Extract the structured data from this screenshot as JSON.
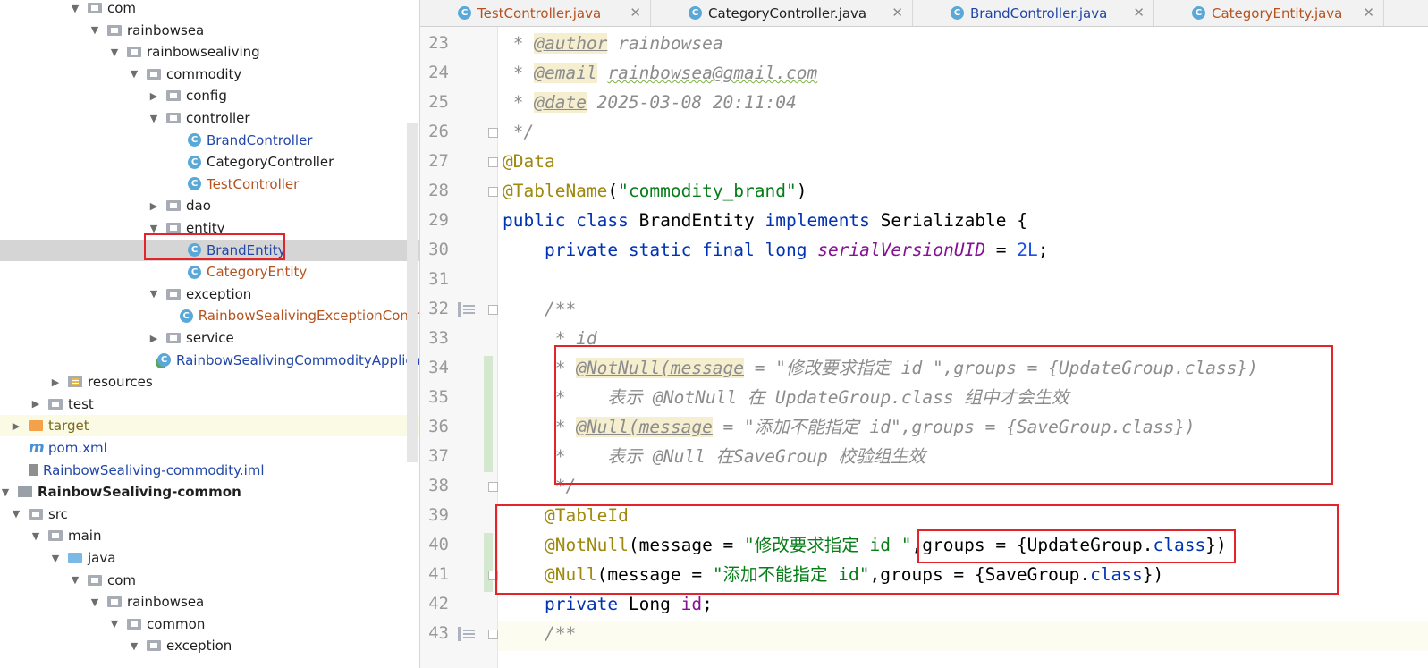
{
  "tree": {
    "rows": [
      {
        "label": "com",
        "indent": 78,
        "arrow": "▼",
        "icon": "folder",
        "color": "",
        "selected": false
      },
      {
        "label": "rainbowsea",
        "indent": 100,
        "arrow": "▼",
        "icon": "folder",
        "color": ""
      },
      {
        "label": "rainbowsealiving",
        "indent": 122,
        "arrow": "▼",
        "icon": "folder",
        "color": ""
      },
      {
        "label": "commodity",
        "indent": 144,
        "arrow": "▼",
        "icon": "folder",
        "color": ""
      },
      {
        "label": "config",
        "indent": 166,
        "arrow": "▶",
        "icon": "folder",
        "color": ""
      },
      {
        "label": "controller",
        "indent": 166,
        "arrow": "▼",
        "icon": "folder",
        "color": ""
      },
      {
        "label": "BrandController",
        "indent": 190,
        "arrow": "",
        "icon": "class",
        "color": "blue"
      },
      {
        "label": "CategoryController",
        "indent": 190,
        "arrow": "",
        "icon": "class",
        "color": ""
      },
      {
        "label": "TestController",
        "indent": 190,
        "arrow": "",
        "icon": "class",
        "color": "orange"
      },
      {
        "label": "dao",
        "indent": 166,
        "arrow": "▶",
        "icon": "folder",
        "color": ""
      },
      {
        "label": "entity",
        "indent": 166,
        "arrow": "▼",
        "icon": "folder",
        "color": ""
      },
      {
        "label": "BrandEntity",
        "indent": 190,
        "arrow": "",
        "icon": "class",
        "color": "blue",
        "selected": true
      },
      {
        "label": "CategoryEntity",
        "indent": 190,
        "arrow": "",
        "icon": "class",
        "color": "orange"
      },
      {
        "label": "exception",
        "indent": 166,
        "arrow": "▼",
        "icon": "folder",
        "color": ""
      },
      {
        "label": "RainbowSealivingExceptionContr",
        "indent": 190,
        "arrow": "",
        "icon": "class",
        "color": "orange"
      },
      {
        "label": "service",
        "indent": 166,
        "arrow": "▶",
        "icon": "folder",
        "color": ""
      },
      {
        "label": "RainbowSealivingCommodityApplica",
        "indent": 168,
        "arrow": "",
        "icon": "app",
        "color": "blue"
      },
      {
        "label": "resources",
        "indent": 56,
        "arrow": "▶",
        "icon": "resources",
        "color": ""
      },
      {
        "label": "test",
        "indent": 34,
        "arrow": "▶",
        "icon": "folder",
        "color": ""
      },
      {
        "label": "target",
        "indent": 12,
        "arrow": "▶",
        "icon": "folder-orange",
        "color": "olive",
        "hl": true
      },
      {
        "label": "pom.xml",
        "indent": 12,
        "arrow": "",
        "icon": "maven",
        "color": "blue"
      },
      {
        "label": "RainbowSealiving-commodity.iml",
        "indent": 12,
        "arrow": "",
        "icon": "iml",
        "color": "blue"
      },
      {
        "label": "RainbowSealiving-common",
        "indent": 0,
        "arrow": "▼",
        "icon": "module",
        "color": "",
        "bold": true
      },
      {
        "label": "src",
        "indent": 12,
        "arrow": "▼",
        "icon": "folder",
        "color": ""
      },
      {
        "label": "main",
        "indent": 34,
        "arrow": "▼",
        "icon": "folder",
        "color": ""
      },
      {
        "label": "java",
        "indent": 56,
        "arrow": "▼",
        "icon": "folder-blue",
        "color": ""
      },
      {
        "label": "com",
        "indent": 78,
        "arrow": "▼",
        "icon": "folder",
        "color": ""
      },
      {
        "label": "rainbowsea",
        "indent": 100,
        "arrow": "▼",
        "icon": "folder",
        "color": ""
      },
      {
        "label": "common",
        "indent": 122,
        "arrow": "▼",
        "icon": "folder",
        "color": ""
      },
      {
        "label": "exception",
        "indent": 144,
        "arrow": "▼",
        "icon": "folder",
        "color": ""
      }
    ]
  },
  "tabs": [
    {
      "label": "TestController.java",
      "color": "#b5531f",
      "close": "✕"
    },
    {
      "label": "CategoryController.java",
      "color": "#1f1f1f",
      "close": "✕"
    },
    {
      "label": "BrandController.java",
      "color": "#2146a8",
      "close": "✕"
    },
    {
      "label": "CategoryEntity.java",
      "color": "#b5531f",
      "close": "✕"
    }
  ],
  "editor": {
    "lines": [
      {
        "n": "23",
        "segs": [
          {
            "c": "cm",
            "t": " * "
          },
          {
            "c": "tag",
            "t": "@author"
          },
          {
            "c": "cm",
            "t": " rainbowsea"
          }
        ]
      },
      {
        "n": "24",
        "segs": [
          {
            "c": "cm",
            "t": " * "
          },
          {
            "c": "tag",
            "t": "@email"
          },
          {
            "c": "cm",
            "t": " "
          },
          {
            "c": "cm squig",
            "t": "rainbowsea@gmail.com"
          }
        ]
      },
      {
        "n": "25",
        "segs": [
          {
            "c": "cm",
            "t": " * "
          },
          {
            "c": "tag",
            "t": "@date"
          },
          {
            "c": "cm",
            "t": " 2025-03-08 20:11:04"
          }
        ]
      },
      {
        "n": "26",
        "segs": [
          {
            "c": "cm",
            "t": " */"
          }
        ]
      },
      {
        "n": "27",
        "segs": [
          {
            "c": "ann",
            "t": "@Data"
          }
        ]
      },
      {
        "n": "28",
        "segs": [
          {
            "c": "ann",
            "t": "@TableName"
          },
          {
            "c": "",
            "t": "("
          },
          {
            "c": "str",
            "t": "\"commodity_brand\""
          },
          {
            "c": "",
            "t": ")"
          }
        ]
      },
      {
        "n": "29",
        "segs": [
          {
            "c": "kw",
            "t": "public class "
          },
          {
            "c": "",
            "t": "BrandEntity "
          },
          {
            "c": "kw",
            "t": "implements "
          },
          {
            "c": "",
            "t": "Serializable {"
          }
        ]
      },
      {
        "n": "30",
        "segs": [
          {
            "c": "",
            "t": "    "
          },
          {
            "c": "kw",
            "t": "private static final long "
          },
          {
            "c": "fld",
            "t": "serialVersionUID"
          },
          {
            "c": "",
            "t": " = "
          },
          {
            "c": "num",
            "t": "2L"
          },
          {
            "c": "",
            "t": ";"
          }
        ]
      },
      {
        "n": "31",
        "segs": []
      },
      {
        "n": "32",
        "segs": [
          {
            "c": "cm",
            "t": "    /**"
          }
        ]
      },
      {
        "n": "33",
        "segs": [
          {
            "c": "cm",
            "t": "     * id"
          }
        ]
      },
      {
        "n": "34",
        "segs": [
          {
            "c": "cm",
            "t": "     * "
          },
          {
            "c": "tag",
            "t": "@NotNull(message"
          },
          {
            "c": "cm",
            "t": " = \"修改要求指定 id \",groups = {UpdateGroup.class})"
          }
        ]
      },
      {
        "n": "35",
        "segs": [
          {
            "c": "cm",
            "t": "     *    表示 @NotNull 在 UpdateGroup.class 组中才会生效"
          }
        ]
      },
      {
        "n": "36",
        "segs": [
          {
            "c": "cm",
            "t": "     * "
          },
          {
            "c": "tag",
            "t": "@Null(message"
          },
          {
            "c": "cm",
            "t": " = \"添加不能指定 id\",groups = {SaveGroup.class})"
          }
        ]
      },
      {
        "n": "37",
        "segs": [
          {
            "c": "cm",
            "t": "     *    表示 @Null 在SaveGroup 校验组生效"
          }
        ]
      },
      {
        "n": "38",
        "segs": [
          {
            "c": "cm",
            "t": "     */"
          }
        ]
      },
      {
        "n": "39",
        "segs": [
          {
            "c": "",
            "t": "    "
          },
          {
            "c": "ann",
            "t": "@TableId"
          }
        ]
      },
      {
        "n": "40",
        "segs": [
          {
            "c": "",
            "t": "    "
          },
          {
            "c": "ann",
            "t": "@NotNull"
          },
          {
            "c": "",
            "t": "(message = "
          },
          {
            "c": "str",
            "t": "\"修改要求指定 id \""
          },
          {
            "c": "",
            "t": ",groups = {UpdateGroup."
          },
          {
            "c": "kw",
            "t": "class"
          },
          {
            "c": "",
            "t": "})"
          }
        ]
      },
      {
        "n": "41",
        "segs": [
          {
            "c": "",
            "t": "    "
          },
          {
            "c": "ann",
            "t": "@Null"
          },
          {
            "c": "",
            "t": "(message = "
          },
          {
            "c": "str",
            "t": "\"添加不能指定 id\""
          },
          {
            "c": "",
            "t": ",groups = {SaveGroup."
          },
          {
            "c": "kw",
            "t": "class"
          },
          {
            "c": "",
            "t": "})"
          }
        ]
      },
      {
        "n": "42",
        "segs": [
          {
            "c": "",
            "t": "    "
          },
          {
            "c": "kw",
            "t": "private "
          },
          {
            "c": "",
            "t": "Long "
          },
          {
            "c": "fld2",
            "t": "id"
          },
          {
            "c": "",
            "t": ";"
          }
        ]
      },
      {
        "n": "43",
        "segs": [
          {
            "c": "cm",
            "t": "    /**"
          }
        ]
      }
    ]
  }
}
